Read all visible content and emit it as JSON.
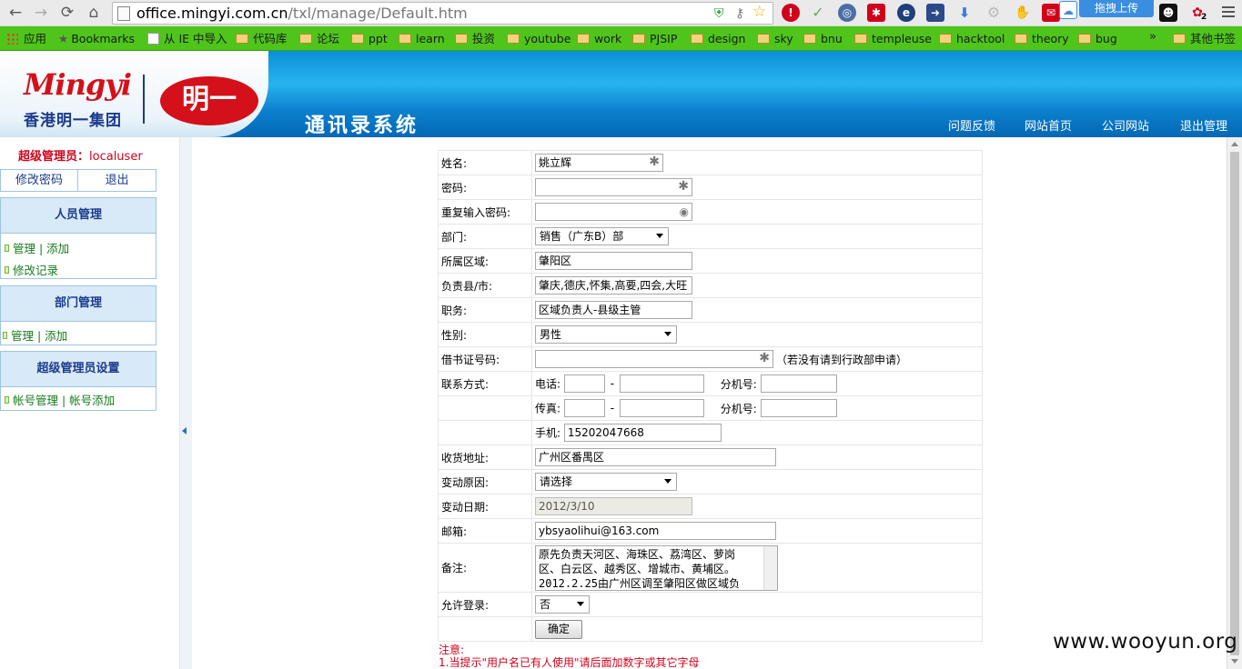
{
  "browser": {
    "url_host": "office.mingyi.com.cn",
    "url_path": "/txl/manage/Default.htm",
    "upload_button": "拖拽上传",
    "ext_badge": "2"
  },
  "bookmarks": [
    "应用",
    "Bookmarks",
    "从 IE 中导入",
    "代码库",
    "论坛",
    "ppt",
    "learn",
    "投资",
    "youtube",
    "work",
    "PJSIP",
    "design",
    "sky",
    "bnu",
    "templeuse",
    "hacktool",
    "theory",
    "bug",
    "»",
    "其他书签"
  ],
  "site": {
    "logo_en": "Mingyi",
    "logo_cn": "香港明一集团",
    "logo_mark": "明一",
    "title": "通讯录系统",
    "nav": [
      "问题反馈",
      "网站首页",
      "公司网站",
      "退出管理"
    ]
  },
  "sidebar": {
    "admin_label": "超级管理员：",
    "admin_user": "localuser",
    "change_password": "修改密码",
    "logout": "退出",
    "sections": [
      {
        "title": "人员管理",
        "links": [
          "管理 | 添加",
          "修改记录"
        ]
      },
      {
        "title": "部门管理",
        "links": [
          "管理 | 添加"
        ]
      },
      {
        "title": "超级管理员设置",
        "links": [
          "帐号管理 | 帐号添加"
        ]
      }
    ]
  },
  "form": {
    "labels": {
      "name": "姓名:",
      "password": "密码:",
      "password_repeat": "重复输入密码:",
      "department": "部门:",
      "region": "所属区域:",
      "counties": "负责县/市:",
      "position": "职务:",
      "gender": "性别:",
      "library_card": "借书证号码:",
      "contact": "联系方式:",
      "phone": "电话:",
      "extension": "分机号:",
      "fax": "传真:",
      "mobile": "手机:",
      "address": "收货地址:",
      "change_reason": "变动原因:",
      "change_date": "变动日期:",
      "email": "邮箱:",
      "remark": "备注:",
      "allow_login": "允许登录:",
      "dash": "-"
    },
    "values": {
      "name": "姚立辉",
      "department": "销售（广东B）部",
      "region": "肇阳区",
      "counties": "肇庆,德庆,怀集,高要,四会,大旺",
      "position": "区域负责人-县级主管",
      "gender": "男性",
      "mobile": "15202047668",
      "address": "广州区番禺区",
      "change_reason": "请选择",
      "change_date": "2012/3/10",
      "email": "ybsyaolihui@163.com",
      "remark_lines": [
        "原先负责天河区、海珠区、荔湾区、萝岗",
        "区、白云区、越秀区、增城市、黄埔区。",
        "2012.2.25由广州区调至肇阳区做区域负"
      ],
      "allow_login": "否"
    },
    "required_mark": "✱",
    "library_hint": "（若没有请到行政部申请）",
    "submit": "确定"
  },
  "notes": {
    "title": "注意:",
    "line1": "1.当提示\"用户名已有人使用\"请后面加数字或其它字母"
  },
  "watermark": "www.wooyun.org"
}
